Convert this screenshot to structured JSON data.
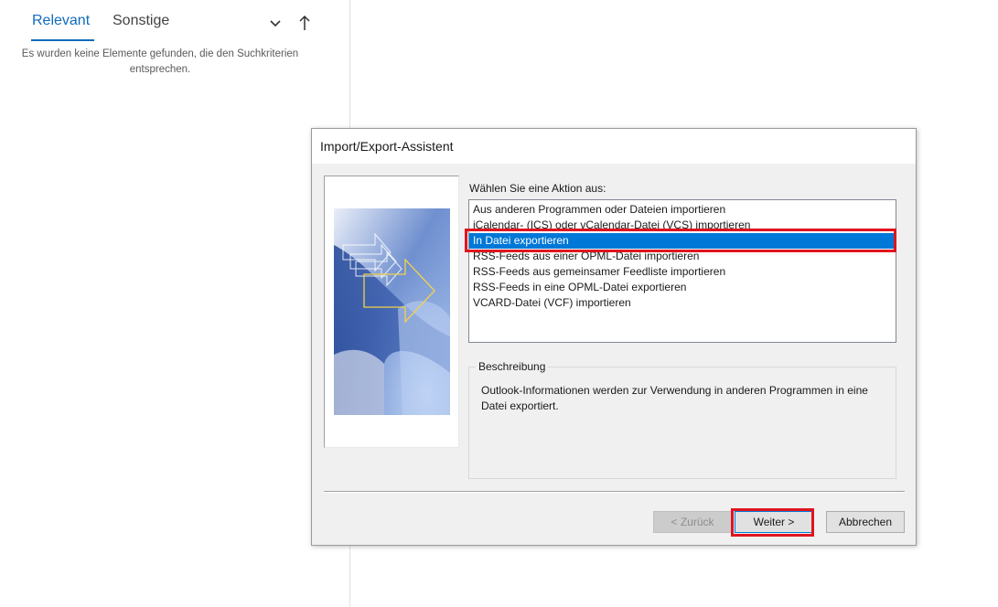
{
  "mail_list": {
    "tabs": [
      {
        "label": "Relevant",
        "active": true
      },
      {
        "label": "Sonstige",
        "active": false
      }
    ],
    "empty_message": "Es wurden keine Elemente gefunden, die den Suchkriterien entsprechen.",
    "icons": [
      "chevron-down-icon",
      "sort-up-arrow-icon"
    ]
  },
  "dialog": {
    "title": "Import/Export-Assistent",
    "prompt": "Wählen Sie eine Aktion aus:",
    "actions": [
      "Aus anderen Programmen oder Dateien importieren",
      "iCalendar- (ICS) oder vCalendar-Datei (VCS) importieren",
      "In Datei exportieren",
      "RSS-Feeds aus einer OPML-Datei importieren",
      "RSS-Feeds aus gemeinsamer Feedliste importieren",
      "RSS-Feeds in eine OPML-Datei exportieren",
      "VCARD-Datei (VCF) importieren"
    ],
    "selected_action": "In Datei exportieren",
    "description_label": "Beschreibung",
    "description_text": "Outlook-Informationen werden zur Verwendung in anderen Programmen in eine Datei exportiert.",
    "buttons": {
      "back": "< Zurück",
      "next": "Weiter >",
      "cancel": "Abbrechen"
    }
  },
  "colors": {
    "accent": "#0f6cbd",
    "selection": "#0078d7",
    "highlight": "#e0141e"
  }
}
